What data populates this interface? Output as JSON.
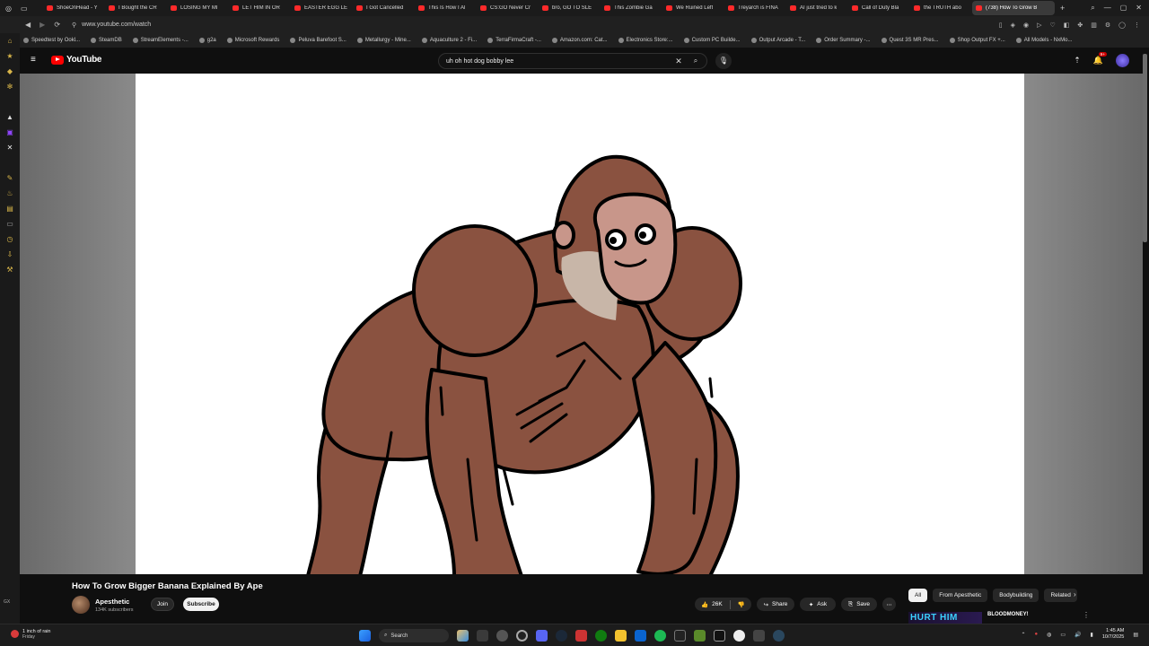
{
  "browser": {
    "tabs": [
      {
        "label": "ShoeOnHead - Y"
      },
      {
        "label": "I Bought the CR"
      },
      {
        "label": "LOSING MY MI"
      },
      {
        "label": "LET HIM IN OR"
      },
      {
        "label": "EASTER EGG LE"
      },
      {
        "label": "I Got Cancelled"
      },
      {
        "label": "This Is How I Al"
      },
      {
        "label": "CS:GO Never Cr"
      },
      {
        "label": "bro, GO TO SLE"
      },
      {
        "label": "This Zombie Ga"
      },
      {
        "label": "We Ruined Left"
      },
      {
        "label": "Treyarch is FINA"
      },
      {
        "label": "AI just tried to k"
      },
      {
        "label": "Call of Duty Bla"
      },
      {
        "label": "the TRUTH abo"
      },
      {
        "label": "(738) How To Grow B"
      }
    ],
    "url": "www.youtube.com/watch",
    "bookmarks": [
      "Speedtest by Ookl...",
      "SteamDB",
      "StreamElements -...",
      "g2a",
      "Microsoft Rewards",
      "Peluva Barefoot S...",
      "Metallurgy - Mine...",
      "Aquaculture 2 - Fi...",
      "TerraFirmaCraft -...",
      "Amazon.com: Cat...",
      "Electronics Store:...",
      "Custom PC Builde...",
      "Output Arcade - T...",
      "Order Summary -...",
      "Quest 3S MR Pres...",
      "Shop Output FX +...",
      "All Models - NxMo..."
    ]
  },
  "youtube": {
    "logo_text": "YouTube",
    "search_query": "uh oh hot dog bobby lee",
    "notification_count": "9+",
    "video": {
      "title": "How To Grow Bigger Banana Explained By Ape",
      "channel": "Apesthetic",
      "subscribers": "134K subscribers",
      "join_label": "Join",
      "subscribe_label": "Subscribe",
      "likes": "26K",
      "share_label": "Share",
      "ask_label": "Ask",
      "save_label": "Save"
    },
    "chips": [
      "All",
      "From Apesthetic",
      "Bodybuilding",
      "Related"
    ],
    "next_video_title": "BLOODMONEY!",
    "next_video_thumb_text": "HURT HIM"
  },
  "taskbar": {
    "weather_line1": "1 inch of rain",
    "weather_line2": "Friday",
    "search_label": "Search",
    "time": "1:45 AM",
    "date": "10/7/2025"
  },
  "colors": {
    "accent": "#ff0000",
    "ape_fur": "#8a5240",
    "ape_face": "#c8968a"
  }
}
